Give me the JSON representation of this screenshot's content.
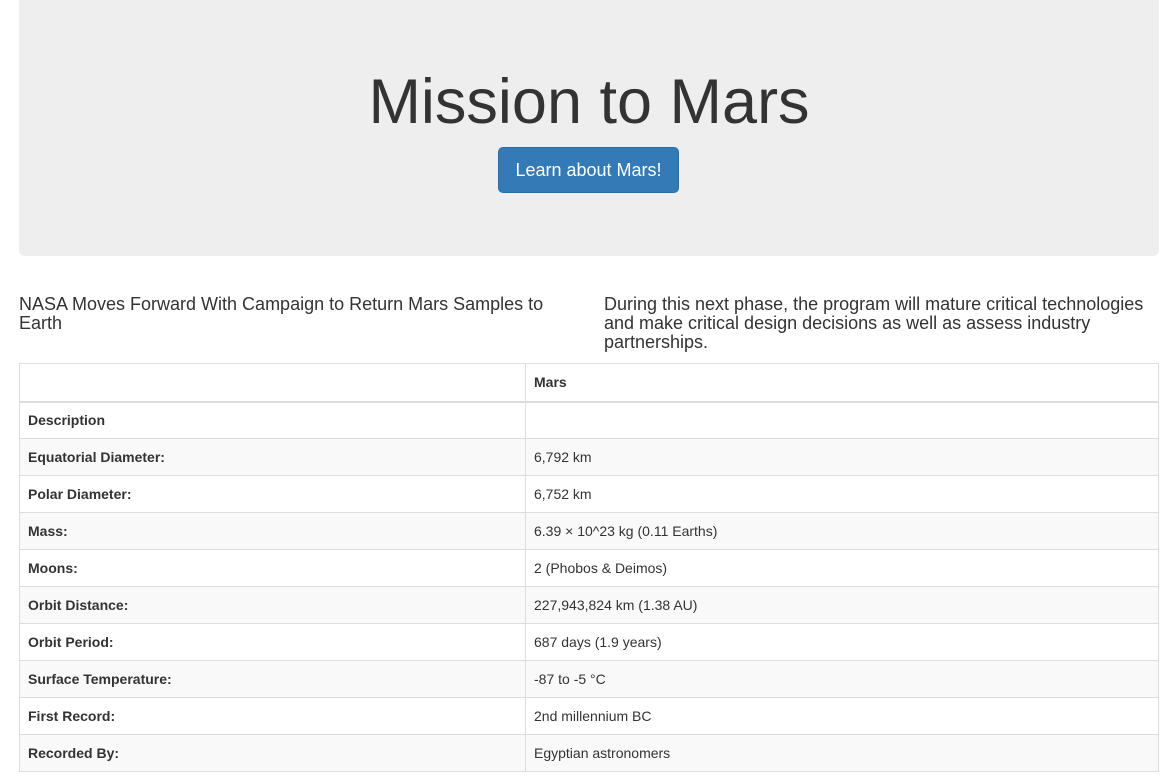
{
  "header": {
    "title": "Mission to Mars",
    "button_label": "Learn about Mars!"
  },
  "news": {
    "title": "NASA Moves Forward With Campaign to Return Mars Samples to Earth",
    "paragraph": "During this next phase, the program will mature critical technologies and make critical design decisions as well as assess industry partnerships."
  },
  "facts": {
    "header": [
      "",
      "Mars"
    ],
    "rows": [
      {
        "label": "Description",
        "value": ""
      },
      {
        "label": "Equatorial Diameter:",
        "value": "6,792 km"
      },
      {
        "label": "Polar Diameter:",
        "value": "6,752 km"
      },
      {
        "label": "Mass:",
        "value": "6.39 × 10^23 kg (0.11 Earths)"
      },
      {
        "label": "Moons:",
        "value": "2 (Phobos & Deimos)"
      },
      {
        "label": "Orbit Distance:",
        "value": "227,943,824 km (1.38 AU)"
      },
      {
        "label": "Orbit Period:",
        "value": "687 days (1.9 years)"
      },
      {
        "label": "Surface Temperature:",
        "value": "-87 to -5 °C"
      },
      {
        "label": "First Record:",
        "value": "2nd millennium BC"
      },
      {
        "label": "Recorded By:",
        "value": "Egyptian astronomers"
      }
    ]
  }
}
